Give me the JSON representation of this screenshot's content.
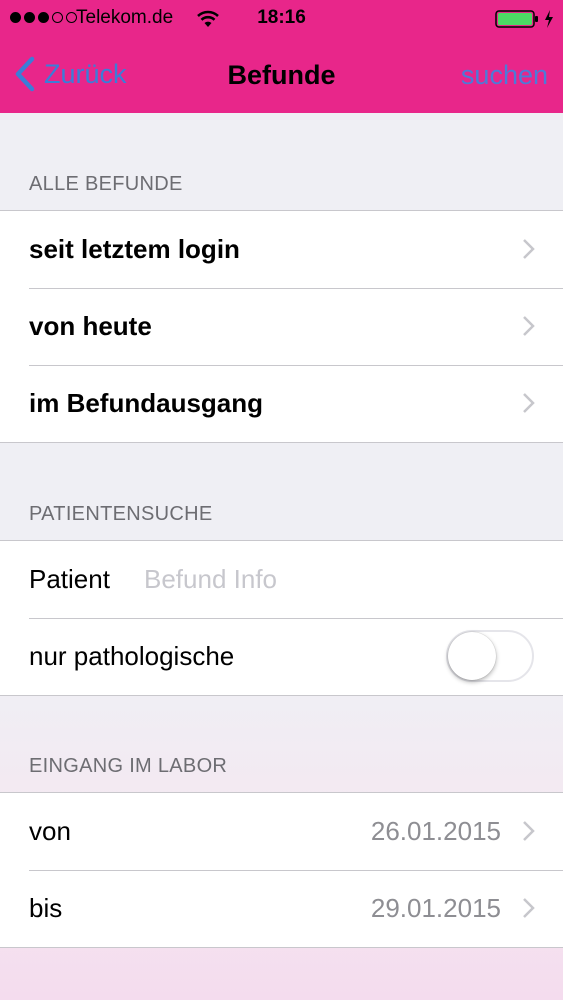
{
  "status_bar": {
    "carrier": "Telekom.de",
    "time": "18:16",
    "signal_bars_filled": 3,
    "signal_bars_total": 5,
    "battery_level": 1.0,
    "battery_color": "#4cd964"
  },
  "nav": {
    "back_label": "Zurück",
    "title": "Befunde",
    "action_label": "suchen",
    "bar_color": "#e8268a",
    "back_color": "#3b7dd8"
  },
  "sections": {
    "alle_befunde": {
      "header": "ALLE BEFUNDE",
      "rows": [
        {
          "label": "seit letztem login"
        },
        {
          "label": "von heute"
        },
        {
          "label": "im Befundausgang"
        }
      ]
    },
    "patientensuche": {
      "header": "PATIENTENSUCHE",
      "patient_label": "Patient",
      "patient_placeholder": "Befund Info",
      "toggle_label": "nur pathologische",
      "toggle_on": false
    },
    "eingang": {
      "header": "EINGANG IM LABOR",
      "rows": [
        {
          "label": "von",
          "value": "26.01.2015"
        },
        {
          "label": "bis",
          "value": "29.01.2015"
        }
      ]
    }
  },
  "icons": {
    "wifi": "wifi-icon",
    "battery": "battery-icon",
    "charging": "charging-bolt-icon",
    "back": "chevron-left-icon",
    "disclosure": "chevron-right-icon"
  }
}
